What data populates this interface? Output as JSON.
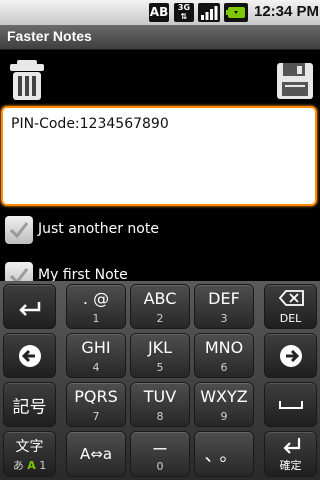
{
  "status_bar": {
    "ab_label": "AB",
    "network_label": "3G",
    "time": "12:34 PM",
    "icons": [
      "ab-icon",
      "3g-icon",
      "signal-icon",
      "battery-icon"
    ]
  },
  "app": {
    "title": "Faster Notes"
  },
  "toolbar": {
    "delete_icon": "trash-icon",
    "save_icon": "floppy-disk-icon"
  },
  "editor": {
    "value": "PIN-Code:1234567890"
  },
  "notes": [
    {
      "label": "Just another note"
    },
    {
      "label": "My first Note"
    }
  ],
  "keyboard": {
    "row1": [
      {
        "name": "undo-key",
        "main": "",
        "sub": "",
        "icon": "undo-arrow-icon"
      },
      {
        "name": "key-1",
        "main": ". @",
        "sub": "1"
      },
      {
        "name": "key-2",
        "main": "ABC",
        "sub": "2"
      },
      {
        "name": "key-3",
        "main": "DEF",
        "sub": "3"
      },
      {
        "name": "delete-key",
        "main": "",
        "sub": "DEL",
        "icon": "backspace-icon"
      }
    ],
    "row2": [
      {
        "name": "left-key",
        "icon": "left-arrow-icon"
      },
      {
        "name": "key-4",
        "main": "GHI",
        "sub": "4"
      },
      {
        "name": "key-5",
        "main": "JKL",
        "sub": "5"
      },
      {
        "name": "key-6",
        "main": "MNO",
        "sub": "6"
      },
      {
        "name": "right-key",
        "icon": "right-arrow-icon"
      }
    ],
    "row3": [
      {
        "name": "symbol-key",
        "main": "記号"
      },
      {
        "name": "key-7",
        "main": "PQRS",
        "sub": "7"
      },
      {
        "name": "key-8",
        "main": "TUV",
        "sub": "8"
      },
      {
        "name": "key-9",
        "main": "WXYZ",
        "sub": "9"
      },
      {
        "name": "space-key",
        "icon": "space-icon"
      }
    ],
    "row4": [
      {
        "name": "mode-key",
        "main": "文字",
        "sub_a": "あ",
        "sub_b": "A",
        "sub_c": "1"
      },
      {
        "name": "case-key",
        "main": "A⇔a"
      },
      {
        "name": "key-0",
        "main": "ー",
        "sub": "0"
      },
      {
        "name": "punct-key",
        "main": "、。"
      },
      {
        "name": "enter-key",
        "main": "",
        "sub": "確定",
        "icon": "enter-icon"
      }
    ]
  },
  "colors": {
    "focus_border": "#ff8a00",
    "background": "#000000",
    "battery_green": "#7ec800"
  }
}
